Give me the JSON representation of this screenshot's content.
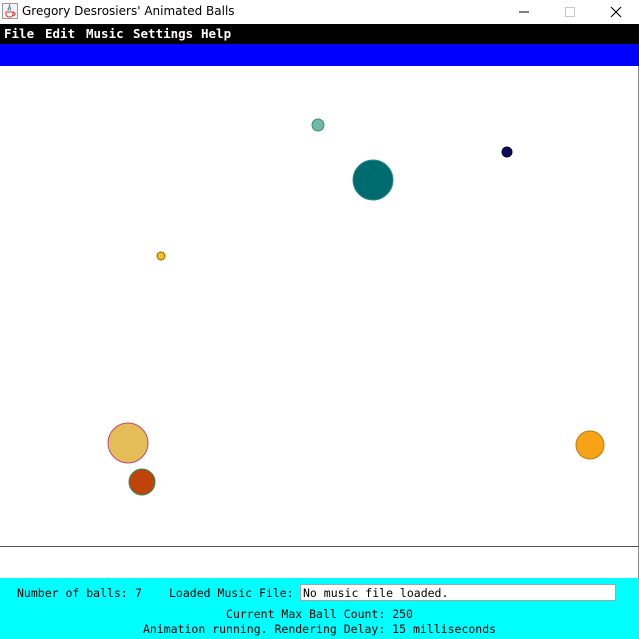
{
  "window": {
    "title": "Gregory Desrosiers' Animated Balls",
    "icon": "java-cup-icon",
    "controls": {
      "minimize": "minimize-icon",
      "maximize": "maximize-icon",
      "close": "close-icon"
    }
  },
  "menu": {
    "items": [
      {
        "label": "File"
      },
      {
        "label": "Edit"
      },
      {
        "label": "Music"
      },
      {
        "label": "Settings"
      },
      {
        "label": "Help"
      }
    ]
  },
  "colors": {
    "menubar": "#000000",
    "toolbar_band": "#0000ff",
    "statusbar": "#00ffff",
    "canvas": "#ffffff"
  },
  "balls": [
    {
      "color": "#6fb8a6"
    },
    {
      "color": "#0b0b5a"
    },
    {
      "color": "#006b6f"
    },
    {
      "color": "#f2be22"
    },
    {
      "color": "#e4bc58"
    },
    {
      "color": "#bf4409"
    },
    {
      "color": "#f6a318"
    }
  ],
  "status": {
    "ball_count_label": "Number of balls:",
    "ball_count": "7",
    "music_label": "Loaded Music File:",
    "music_value": "No music file loaded.",
    "max_ball_count": "Current Max Ball Count: 250",
    "animation_status": "Animation running. Rendering Delay: 15 milliseconds"
  }
}
